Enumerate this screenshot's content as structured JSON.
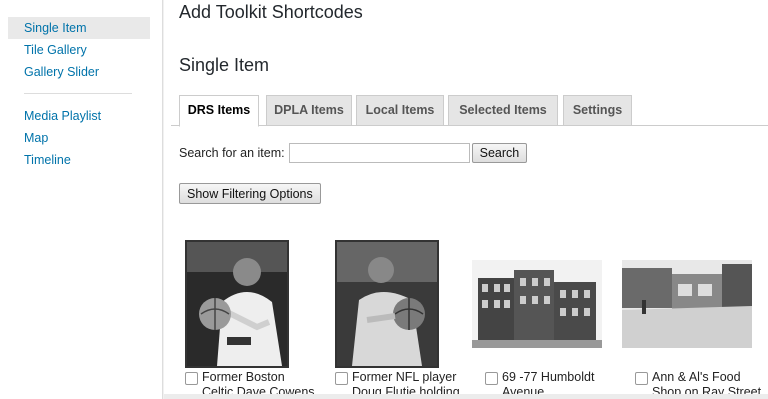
{
  "sidebar": {
    "group1": [
      {
        "label": "Single Item"
      },
      {
        "label": "Tile Gallery"
      },
      {
        "label": "Gallery Slider"
      }
    ],
    "group2": [
      {
        "label": "Media Playlist"
      },
      {
        "label": "Map"
      },
      {
        "label": "Timeline"
      }
    ]
  },
  "main": {
    "page_title": "Add Toolkit Shortcodes",
    "section_title": "Single Item",
    "tabs": [
      {
        "label": "DRS Items"
      },
      {
        "label": "DPLA Items"
      },
      {
        "label": "Local Items"
      },
      {
        "label": "Selected Items"
      },
      {
        "label": "Settings"
      }
    ],
    "search": {
      "label": "Search for an item:",
      "value": "",
      "button": "Search"
    },
    "filter_button": "Show Filtering Options",
    "items": [
      {
        "caption_line1": "Former Boston",
        "caption_line2": "Celtic Dave Cowens"
      },
      {
        "caption_line1": "Former NFL player",
        "caption_line2": "Doug Flutie holding"
      },
      {
        "caption_line1": "69 -77 Humboldt",
        "caption_line2": "Avenue"
      },
      {
        "caption_line1": "Ann & Al's Food",
        "caption_line2": "Shop on Ray Street"
      }
    ]
  },
  "colors": {
    "link": "#0073aa",
    "active_bg": "#e9e9e9",
    "tab_bg": "#e5e5e5"
  }
}
